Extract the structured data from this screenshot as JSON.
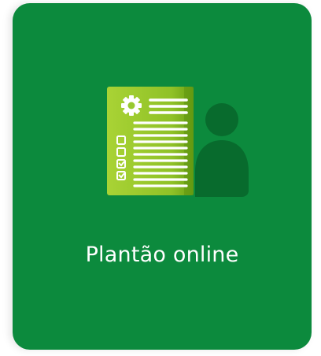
{
  "card": {
    "label": "Plantão online",
    "icon": "online-duty-document-person-icon"
  },
  "colors": {
    "card_background": "#0c8a3d",
    "document_light": "#9fca2e",
    "document_dark": "#6ea416",
    "person": "#086b2d",
    "label_text": "#ffffff"
  }
}
